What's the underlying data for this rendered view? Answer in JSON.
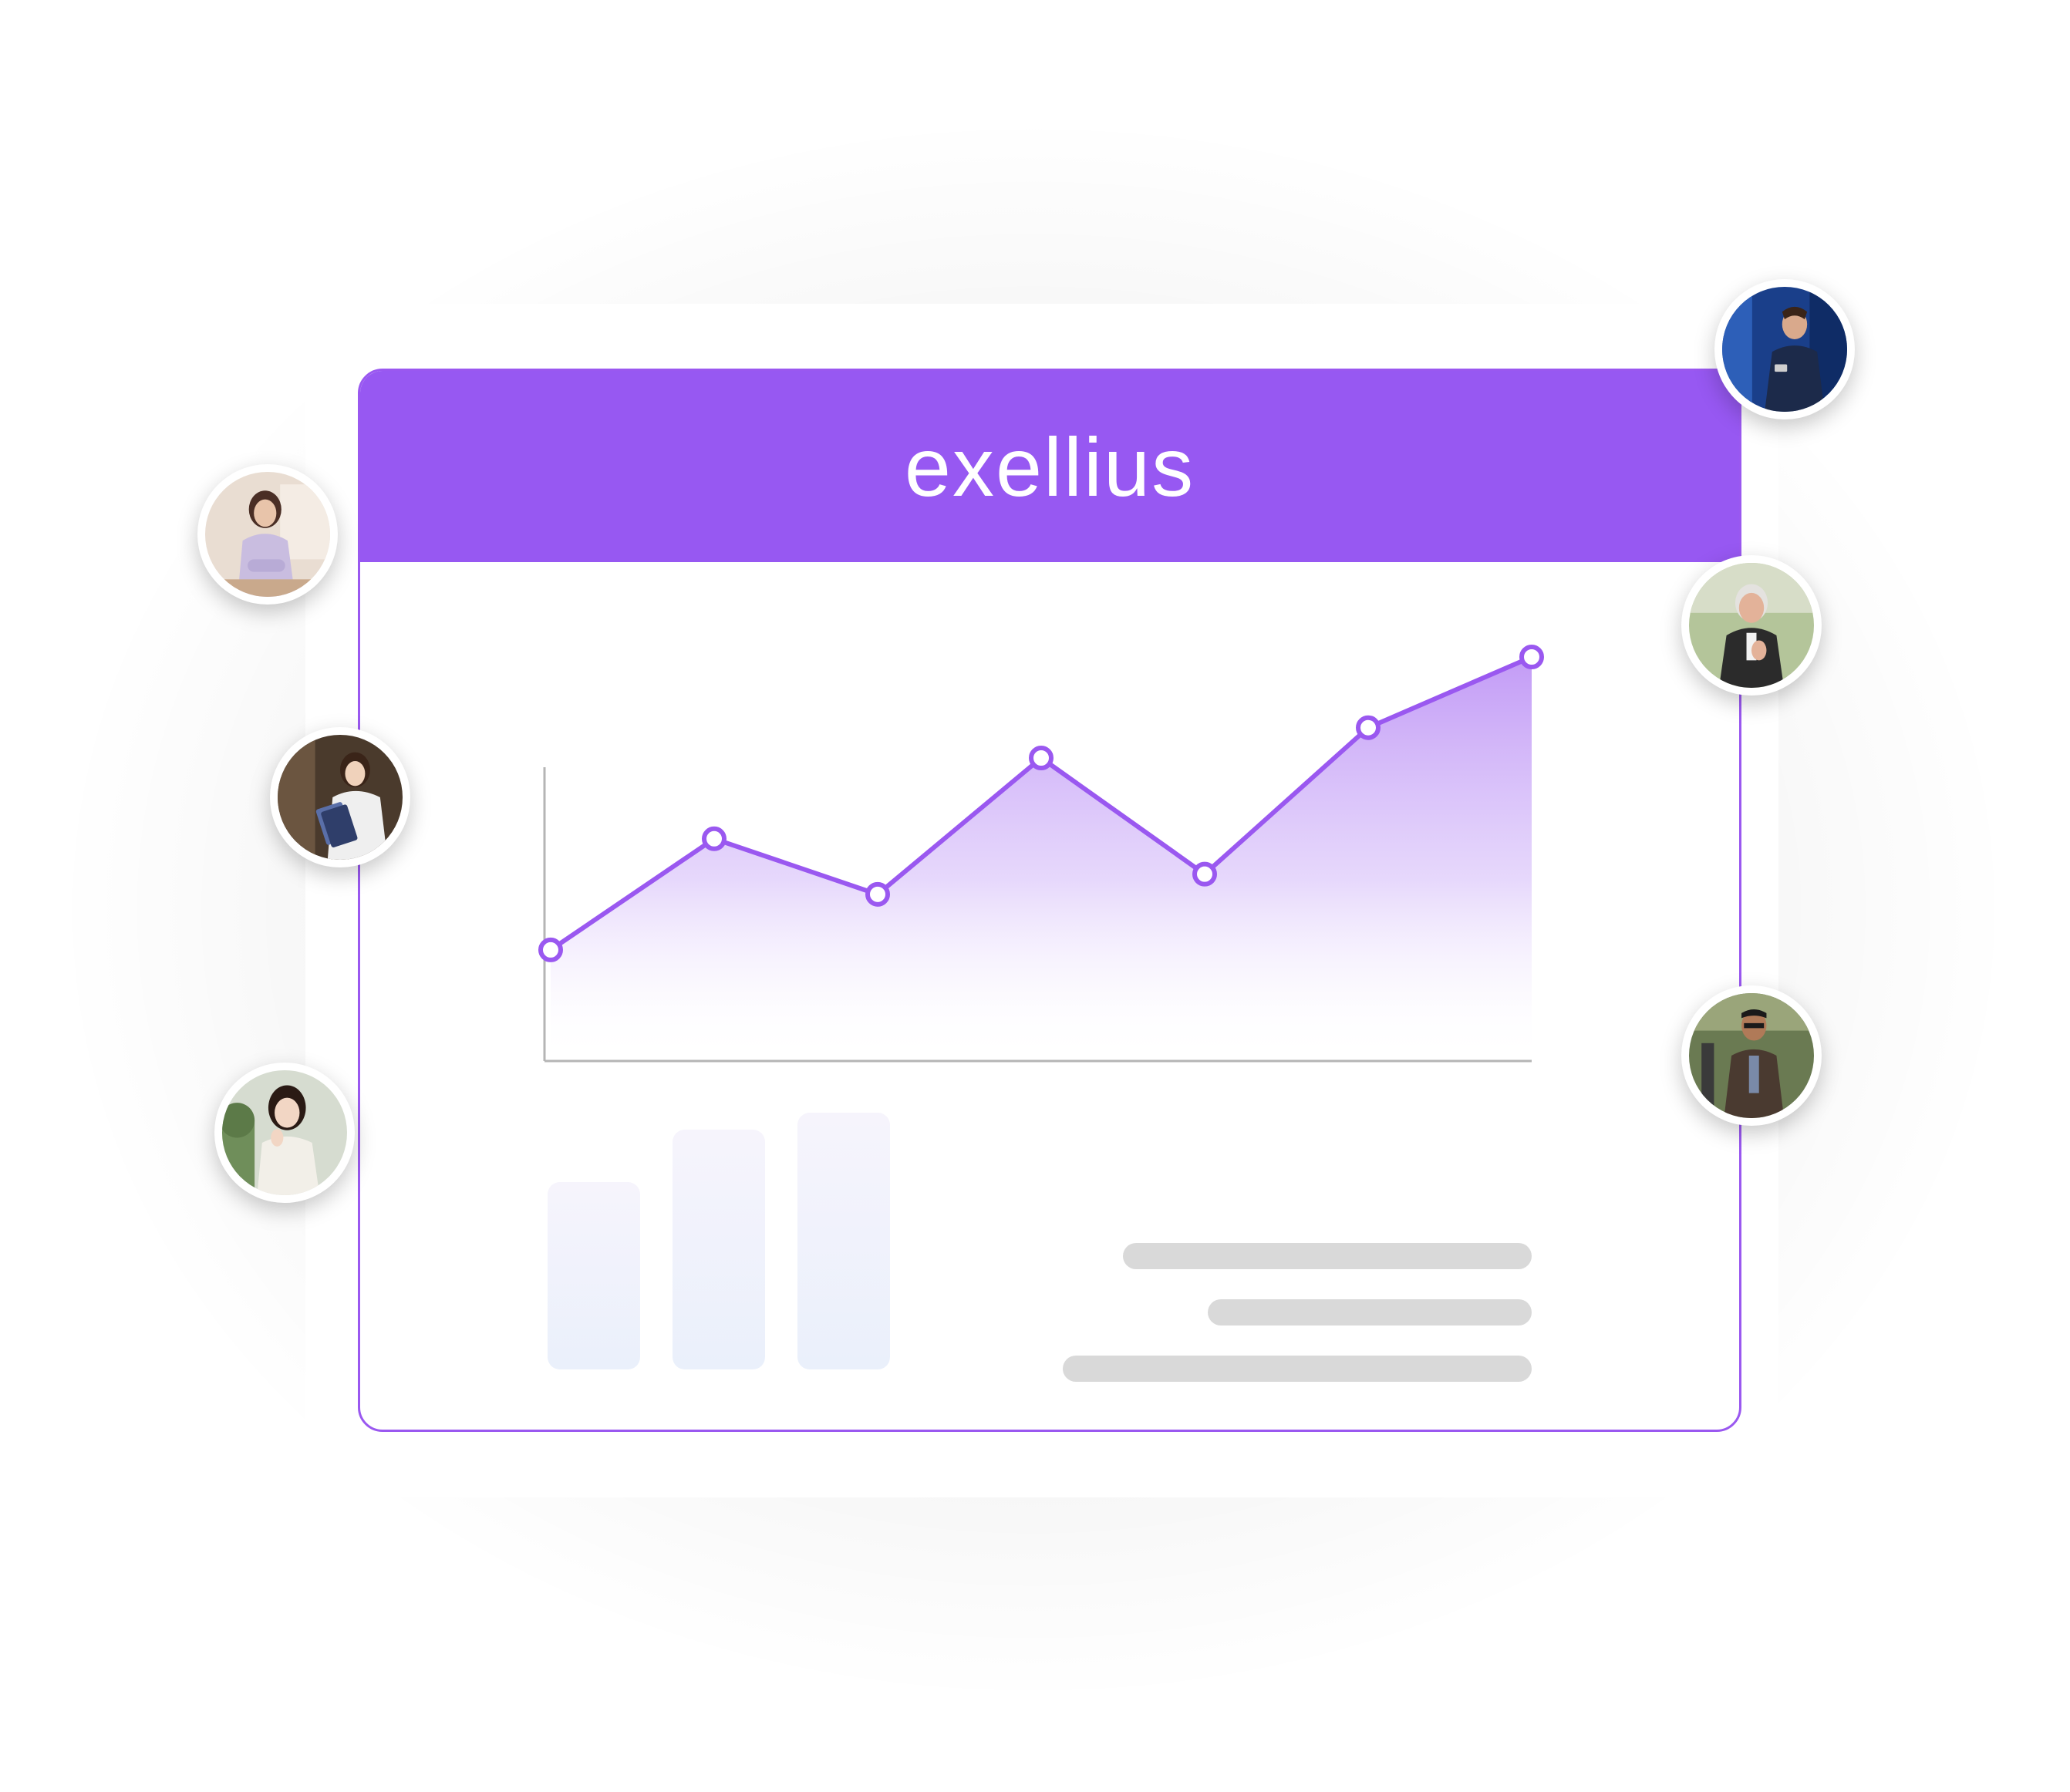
{
  "brand": {
    "name": "exellius",
    "header_color": "#9758f2",
    "accent_color": "#9a58f0"
  },
  "chart_data": {
    "type": "area",
    "x": [
      1,
      2,
      3,
      4,
      5,
      6,
      7
    ],
    "y": [
      22,
      44,
      33,
      60,
      37,
      66,
      80
    ],
    "ylim": [
      0,
      80
    ],
    "grid": false,
    "line_color": "#9a58f0"
  },
  "bars": {
    "values": [
      0.54,
      0.69,
      0.74
    ],
    "color": "#eef1fb"
  },
  "placeholder_lines": {
    "count": 3,
    "color": "#d9d9d9"
  },
  "avatars": [
    {
      "name": "avatar-woman-lavender-suit"
    },
    {
      "name": "avatar-woman-holding-folders"
    },
    {
      "name": "avatar-woman-smiling-plants"
    },
    {
      "name": "avatar-man-blue-suit-phone"
    },
    {
      "name": "avatar-older-man-laughing"
    },
    {
      "name": "avatar-man-glasses-sport-coat"
    }
  ]
}
